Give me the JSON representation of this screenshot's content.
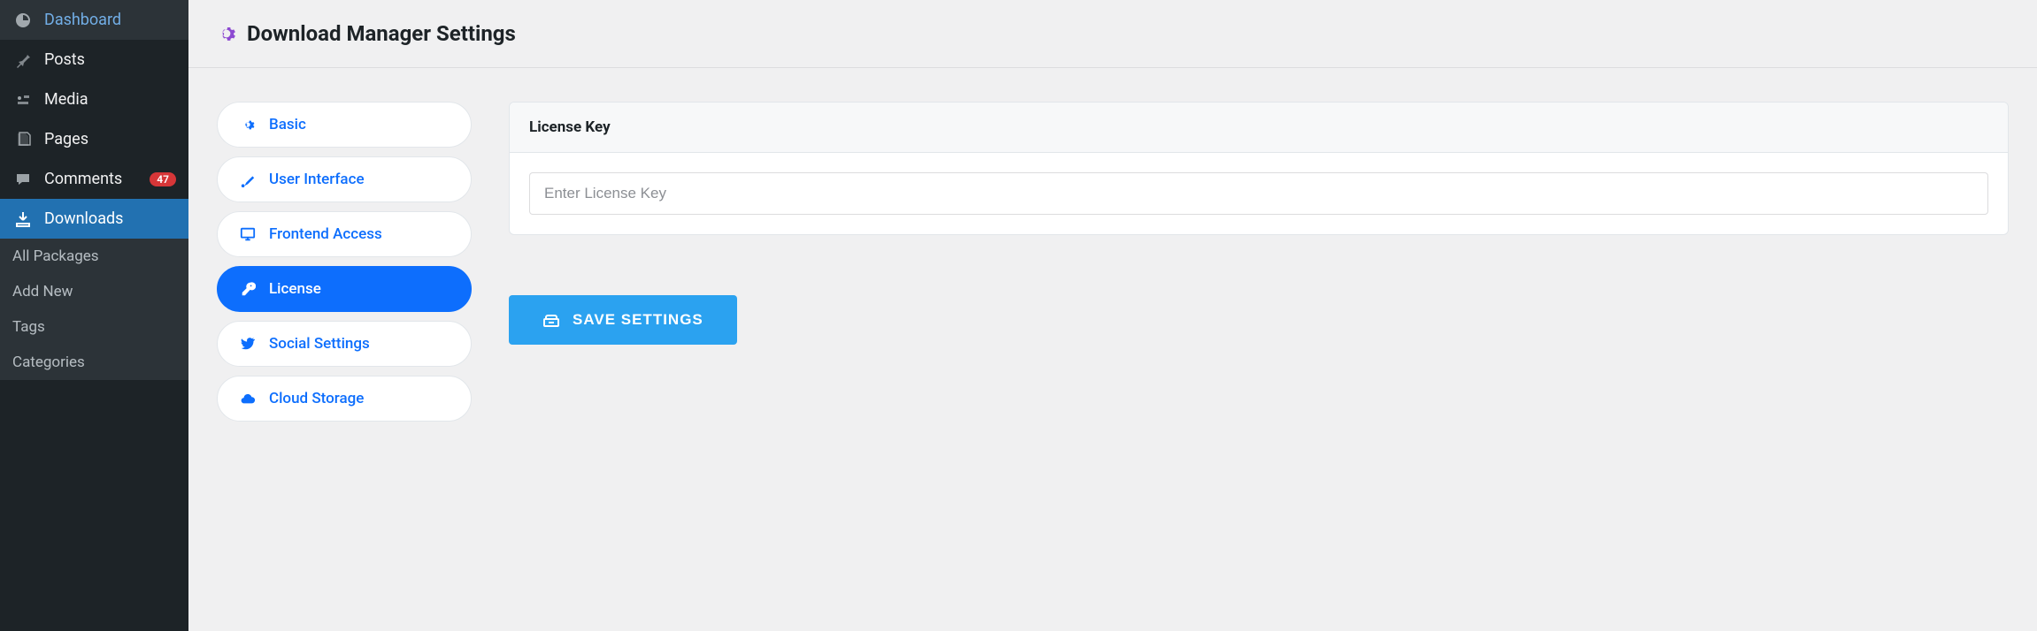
{
  "sidebar": {
    "items": [
      {
        "label": "Dashboard"
      },
      {
        "label": "Posts"
      },
      {
        "label": "Media"
      },
      {
        "label": "Pages"
      },
      {
        "label": "Comments",
        "badge": "47"
      },
      {
        "label": "Downloads"
      }
    ],
    "sub_items": [
      {
        "label": "All Packages"
      },
      {
        "label": "Add New"
      },
      {
        "label": "Tags"
      },
      {
        "label": "Categories"
      }
    ]
  },
  "header": {
    "title": "Download Manager Settings"
  },
  "tabs": [
    {
      "label": "Basic"
    },
    {
      "label": "User Interface"
    },
    {
      "label": "Frontend Access"
    },
    {
      "label": "License"
    },
    {
      "label": "Social Settings"
    },
    {
      "label": "Cloud Storage"
    }
  ],
  "panel": {
    "title": "License Key",
    "input_placeholder": "Enter License Key"
  },
  "buttons": {
    "save": "SAVE SETTINGS"
  }
}
